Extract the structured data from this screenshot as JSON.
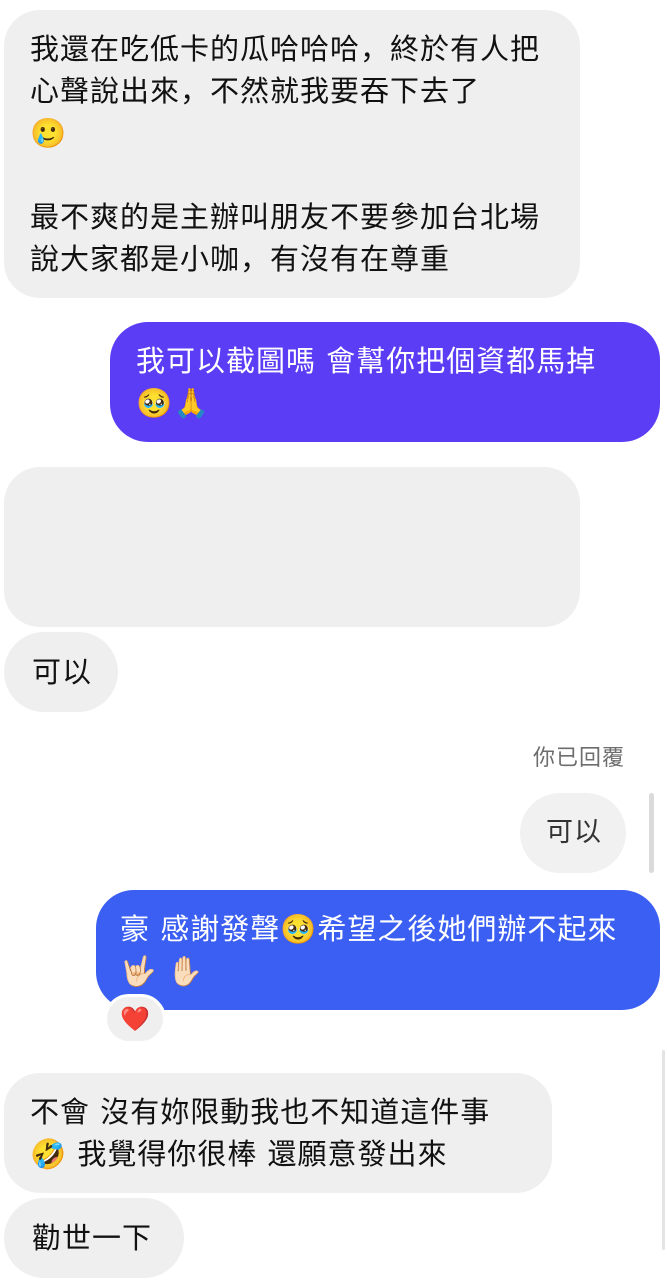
{
  "messages": [
    {
      "direction": "incoming",
      "text": "我還在吃低卡的瓜哈哈哈，終於有人把心聲說出來，不然就我要吞下去了\n🥲\n\n最不爽的是主辦叫朋友不要參加台北場說大家都是小咖，有沒有在尊重"
    },
    {
      "direction": "outgoing",
      "text": "我可以截圖嗎 會幫你把個資都馬掉\n🥹🙏"
    },
    {
      "direction": "incoming",
      "text": ""
    },
    {
      "direction": "incoming",
      "text": "可以"
    },
    {
      "direction": "outgoing",
      "reply_note": "你已回覆",
      "quoted_text": "可以",
      "text": "豪 感謝發聲🥹希望之後她們辦不起來🤟🏻 ✋🏻",
      "reaction": "❤️"
    },
    {
      "direction": "incoming",
      "text": "不會 沒有妳限動我也不知道這件事\n🤣 我覺得你很棒 還願意發出來"
    },
    {
      "direction": "incoming",
      "text": "勸世一下"
    }
  ],
  "colors": {
    "incoming_bubble": "#efefef",
    "outgoing_purple": "#5b3df5",
    "outgoing_blue": "#3a5ff2",
    "reaction_heart": "#e0245e"
  }
}
